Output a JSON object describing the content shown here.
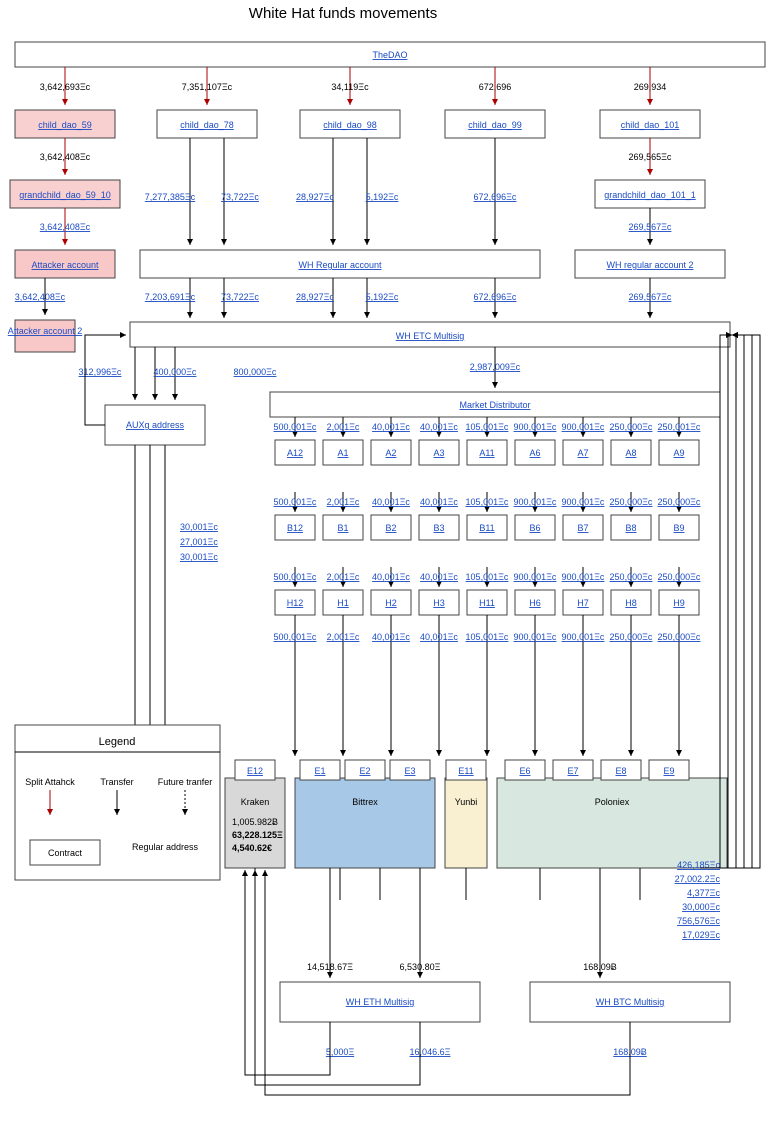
{
  "title": "White Hat funds movements",
  "thedao": "TheDAO",
  "top_amounts": [
    "3,642,693Ξc",
    "7,351,107Ξc",
    "34,119Ξc",
    "672,696",
    "269,934"
  ],
  "child_daos": [
    "child_dao_59",
    "child_dao_78",
    "child_dao_98",
    "child_dao_99",
    "child_dao_101"
  ],
  "gc_amounts_left": "3,642,408Ξc",
  "gc_amounts_right": "269,565Ξc",
  "grandchild_left": "grandchild_dao_59_10",
  "grandchild_right": "grandchild_dao_101_1",
  "gc_mid": [
    "7,277,385Ξc",
    "73,722Ξc",
    "28,927Ξc",
    "5,192Ξc",
    "672,696Ξc"
  ],
  "attacker_amt": "3,642,408Ξc",
  "attacker": "Attacker account",
  "wh_regular": "WH Regular account",
  "wh_regular2": "WH regular account 2",
  "wh_reg2_amt": "269,567Ξc",
  "attacker2_amt": "3,642,408Ξc",
  "attacker2": "Attacker account 2",
  "row3": [
    "7,203,691Ξc",
    "73,722Ξc",
    "28,927Ξc",
    "5,192Ξc",
    "672,696Ξc",
    "269,567Ξc"
  ],
  "wh_etc": "WH ETC Multisig",
  "auxg_amts": [
    "312,996Ξc",
    "400,000Ξc",
    "800,000Ξc"
  ],
  "auxg": "AUXg address",
  "market_amt": "2,987,009Ξc",
  "market": "Market Distributor",
  "grid_vals": [
    "500,001Ξc",
    "2,001Ξc",
    "40,001Ξc",
    "40,001Ξc",
    "105,001Ξc",
    "900,001Ξc",
    "900,001Ξc",
    "250,000Ξc",
    "250,001Ξc"
  ],
  "rowA": [
    "A12",
    "A1",
    "A2",
    "A3",
    "A11",
    "A6",
    "A7",
    "A8",
    "A9"
  ],
  "grid_vals2": [
    "500,001Ξc",
    "2,001Ξc",
    "40,001Ξc",
    "40,001Ξc",
    "105,001Ξc",
    "900,001Ξc",
    "900,001Ξc",
    "250,000Ξc",
    "250,000Ξc"
  ],
  "rowB": [
    "B12",
    "B1",
    "B2",
    "B3",
    "B11",
    "B6",
    "B7",
    "B8",
    "B9"
  ],
  "grid_vals3": [
    "500,001Ξc",
    "2,001Ξc",
    "40,001Ξc",
    "40,001Ξc",
    "105,001Ξc",
    "900,001Ξc",
    "900,001Ξc",
    "250,000Ξc",
    "250,000Ξc"
  ],
  "rowH": [
    "H12",
    "H1",
    "H2",
    "H3",
    "H11",
    "H6",
    "H7",
    "H8",
    "H9"
  ],
  "grid_vals4": [
    "500,001Ξc",
    "2,001Ξc",
    "40,001Ξc",
    "40,001Ξc",
    "105,001Ξc",
    "900,001Ξc",
    "900,001Ξc",
    "250,000Ξc",
    "250,000Ξc"
  ],
  "auxg_side": [
    "30,001Ξc",
    "27,001Ξc",
    "30,001Ξc"
  ],
  "rowE": [
    "E12",
    "E1",
    "E2",
    "E3",
    "E11",
    "E6",
    "E7",
    "E8",
    "E9"
  ],
  "exchanges": [
    "Kraken",
    "Bittrex",
    "Yunbi",
    "Poloniex"
  ],
  "kraken_vals": [
    "1,005.982Ƀ",
    "63,228.125Ξ",
    "4,540.62€"
  ],
  "right_links": [
    "426,185Ξc",
    "27,002.2Ξc",
    "4,377Ξc",
    "30,000Ξc",
    "756,576Ξc",
    "17,029Ξc"
  ],
  "eth_amts": [
    "14,518.67Ξ",
    "6,530.80Ξ"
  ],
  "btc_amt": "168.09Ƀ",
  "wh_eth": "WH ETH Multisig",
  "wh_btc": "WH BTC Multisig",
  "bottom_links": [
    "5,000Ξ",
    "16,046.6Ξ",
    "168.09Ƀ"
  ],
  "legend": {
    "title": "Legend",
    "split": "Split Attahck",
    "transfer": "Transfer",
    "future": "Future tranfer",
    "contract": "Contract",
    "regular": "Regular address"
  }
}
